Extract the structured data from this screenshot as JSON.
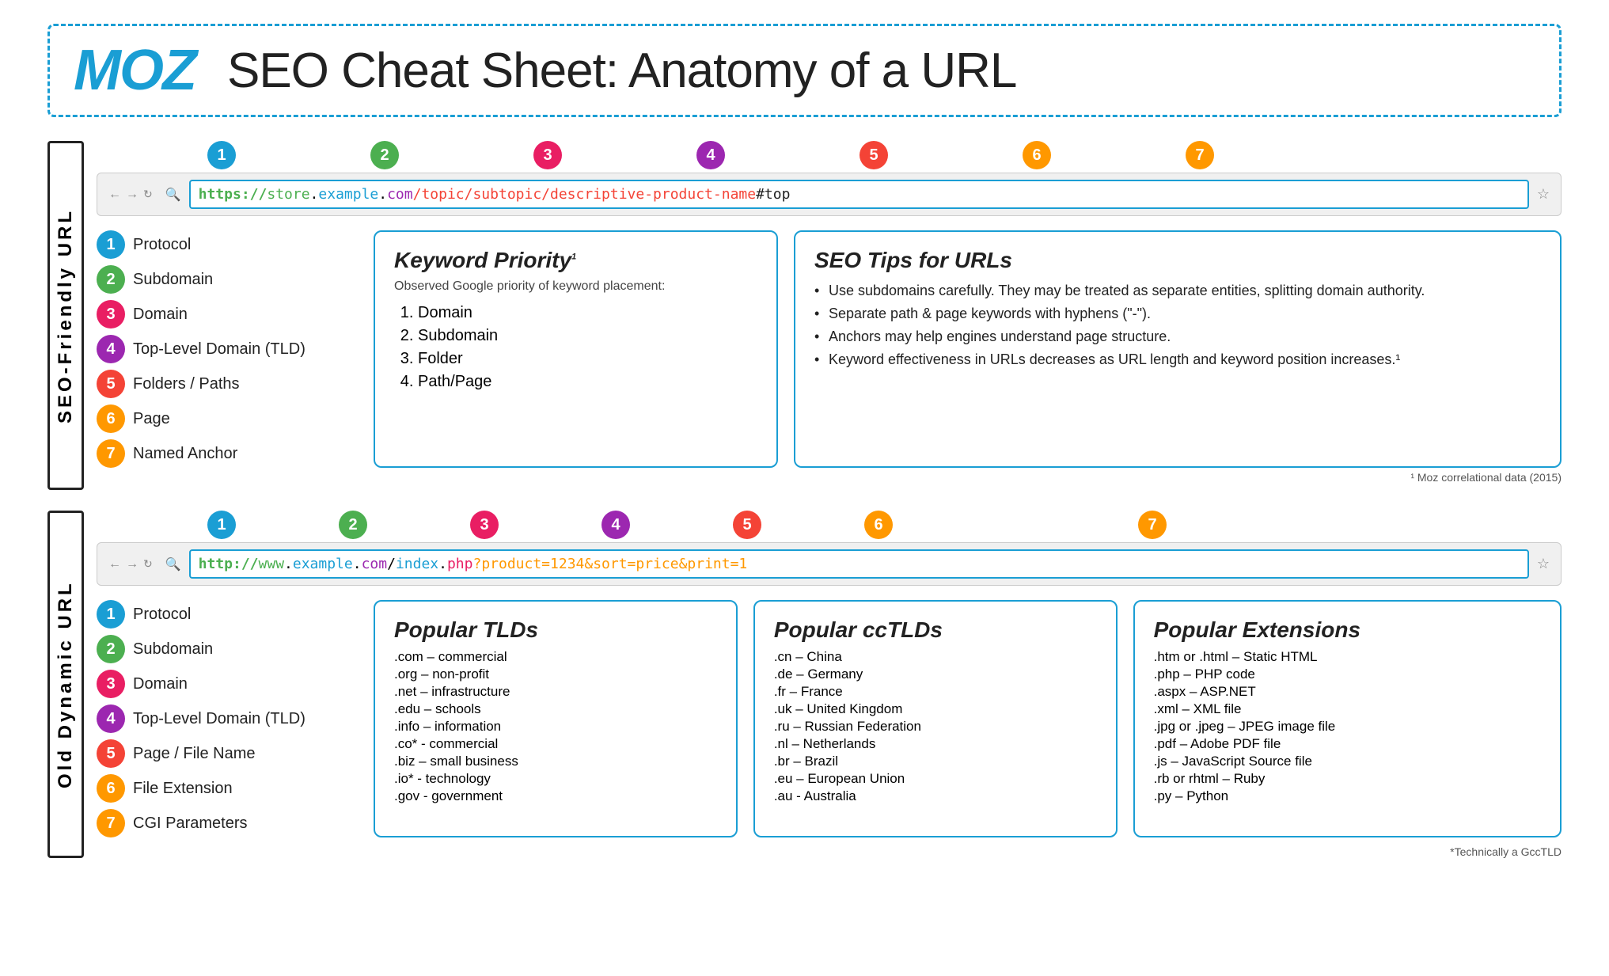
{
  "header": {
    "logo": "MOZ",
    "title": "SEO Cheat Sheet: Anatomy of a URL"
  },
  "seo_section": {
    "label": "SEO-Friendly URL",
    "icon_symbol": "✓",
    "browser_url": {
      "full": "https://store.example.com/topic/subtopic/descriptive-product-name#top",
      "parts": [
        {
          "text": "https://",
          "class": "url-https"
        },
        {
          "text": "store",
          "class": "url-store"
        },
        {
          "text": ".",
          "class": "url-dot"
        },
        {
          "text": "example",
          "class": "url-domain"
        },
        {
          "text": ".",
          "class": "url-dot"
        },
        {
          "text": "com",
          "class": "url-tld"
        },
        {
          "text": "/topic/subtopic/descriptive-product-name",
          "class": "url-path"
        },
        {
          "text": "#top",
          "class": "url-anchor"
        }
      ]
    },
    "bubbles": [
      {
        "num": "1",
        "class": "b1",
        "pos": 0
      },
      {
        "num": "2",
        "class": "b2",
        "pos": 1
      },
      {
        "num": "3",
        "class": "b3",
        "pos": 2
      },
      {
        "num": "4",
        "class": "b4",
        "pos": 3
      },
      {
        "num": "5",
        "class": "b5",
        "pos": 4
      },
      {
        "num": "6",
        "class": "b6",
        "pos": 5
      },
      {
        "num": "7",
        "class": "b7",
        "pos": 6
      }
    ],
    "components": [
      {
        "num": "1",
        "bubble_class": "b1",
        "label": "Protocol"
      },
      {
        "num": "2",
        "bubble_class": "b2",
        "label": "Subdomain"
      },
      {
        "num": "3",
        "bubble_class": "b3",
        "label": "Domain"
      },
      {
        "num": "4",
        "bubble_class": "b4",
        "label": "Top-Level Domain (TLD)"
      },
      {
        "num": "5",
        "bubble_class": "b5",
        "label": "Folders / Paths"
      },
      {
        "num": "6",
        "bubble_class": "b6",
        "label": "Page"
      },
      {
        "num": "7",
        "bubble_class": "b7",
        "label": "Named Anchor"
      }
    ],
    "keyword_priority": {
      "title": "Keyword Priority",
      "superscript": "1",
      "subtitle": "Observed Google priority of keyword placement:",
      "items": [
        "Domain",
        "Subdomain",
        "Folder",
        "Path/Page"
      ]
    },
    "seo_tips": {
      "title": "SEO Tips for URLs",
      "bullets": [
        "Use subdomains carefully. They may be treated as separate entities, splitting domain authority.",
        "Separate path & page keywords with hyphens (\"-\").",
        "Anchors may help engines understand page structure.",
        "Keyword effectiveness in URLs decreases as URL length and keyword position increases.¹"
      ]
    },
    "footnote": "¹ Moz correlational data (2015)"
  },
  "dynamic_section": {
    "label": "Old Dynamic URL",
    "icon_symbol": "✗",
    "browser_url": {
      "full": "http://www.example.com/index.php?product=1234&sort=price&print=1",
      "parts": [
        {
          "text": "http://",
          "class": "url-http"
        },
        {
          "text": "www",
          "class": "url-www"
        },
        {
          "text": ".",
          "class": "url-dot"
        },
        {
          "text": "example",
          "class": "url-domain"
        },
        {
          "text": ".",
          "class": "url-dot"
        },
        {
          "text": "com",
          "class": "url-tld"
        },
        {
          "text": "/",
          "class": "url-dot"
        },
        {
          "text": "index",
          "class": "url-page"
        },
        {
          "text": ".",
          "class": "url-dot"
        },
        {
          "text": "php",
          "class": "url-ext"
        },
        {
          "text": "?product=1234&sort=price&print=1",
          "class": "url-params"
        }
      ]
    },
    "bubbles": [
      {
        "num": "1",
        "class": "b1"
      },
      {
        "num": "2",
        "class": "b2"
      },
      {
        "num": "3",
        "class": "b3"
      },
      {
        "num": "4",
        "class": "b4"
      },
      {
        "num": "5",
        "class": "b5"
      },
      {
        "num": "6",
        "class": "b6"
      },
      {
        "num": "7",
        "class": "b7"
      }
    ],
    "components": [
      {
        "num": "1",
        "bubble_class": "b1",
        "label": "Protocol"
      },
      {
        "num": "2",
        "bubble_class": "b2",
        "label": "Subdomain"
      },
      {
        "num": "3",
        "bubble_class": "b3",
        "label": "Domain"
      },
      {
        "num": "4",
        "bubble_class": "b4",
        "label": "Top-Level Domain (TLD)"
      },
      {
        "num": "5",
        "bubble_class": "b5",
        "label": "Page / File Name"
      },
      {
        "num": "6",
        "bubble_class": "b6",
        "label": "File Extension"
      },
      {
        "num": "7",
        "bubble_class": "b7",
        "label": "CGI Parameters"
      }
    ],
    "popular_tlds": {
      "title": "Popular TLDs",
      "items": [
        ".com – commercial",
        ".org – non-profit",
        ".net – infrastructure",
        ".edu – schools",
        ".info – information",
        ".co* - commercial",
        ".biz – small business",
        ".io* - technology",
        ".gov - government"
      ]
    },
    "popular_cctlds": {
      "title": "Popular ccTLDs",
      "items": [
        ".cn – China",
        ".de – Germany",
        ".fr – France",
        ".uk – United Kingdom",
        ".ru – Russian Federation",
        ".nl – Netherlands",
        ".br – Brazil",
        ".eu – European Union",
        ".au - Australia"
      ]
    },
    "popular_extensions": {
      "title": "Popular Extensions",
      "items": [
        ".htm or .html – Static HTML",
        ".php – PHP code",
        ".aspx – ASP.NET",
        ".xml – XML file",
        ".jpg or .jpeg – JPEG image file",
        ".pdf – Adobe PDF file",
        ".js – JavaScript Source file",
        ".rb or rhtml – Ruby",
        ".py – Python"
      ]
    },
    "footnote": "*Technically a GccTLD"
  }
}
